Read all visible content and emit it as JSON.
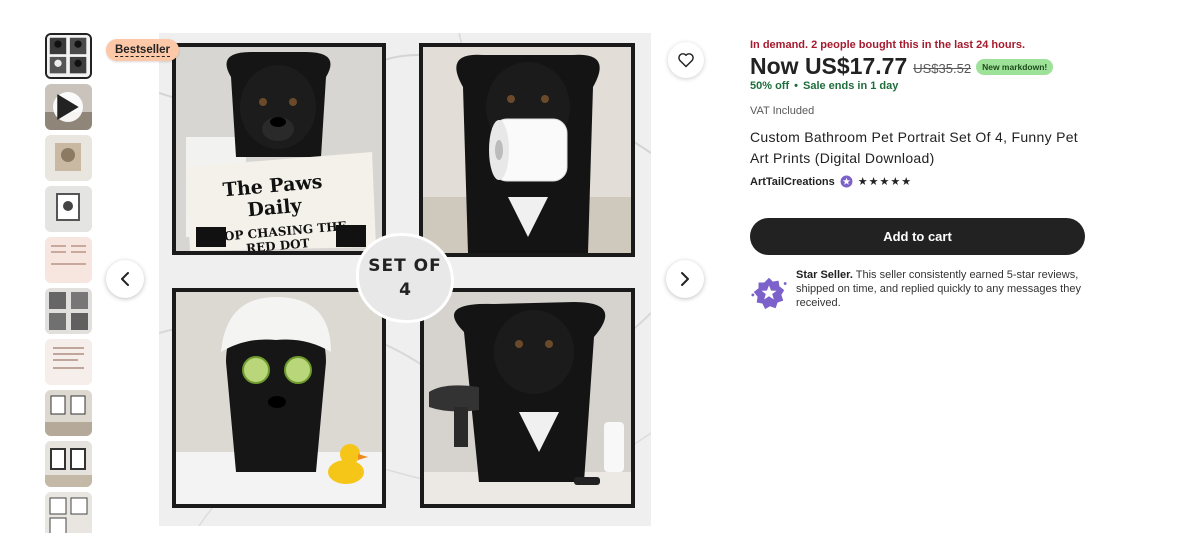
{
  "gallery": {
    "badge": "Bestseller",
    "newspaper_title": "The Paws Daily",
    "newspaper_headline": "STOP CHASING THE RED DOT",
    "set_label_line1": "SET OF",
    "set_label_line2": "4",
    "thumbnail_count": 10
  },
  "listing": {
    "demand_text": "In demand. 2 people bought this in the last 24 hours.",
    "price_now": "Now US$17.77",
    "price_original": "US$35.52",
    "markdown_badge": "New markdown!",
    "discount": "50% off",
    "sale_ends": "Sale ends in 1 day",
    "vat": "VAT Included",
    "title": "Custom Bathroom Pet Portrait Set Of 4, Funny Pet Art Prints (Digital Download)",
    "shop_name": "ArtTailCreations",
    "rating_stars": "★★★★★",
    "rating_value": 5,
    "add_to_cart": "Add to cart",
    "star_seller_label": "Star Seller.",
    "star_seller_text": "This seller consistently earned 5-star reviews, shipped on time, and replied quickly to any messages they received."
  },
  "colors": {
    "demand_red": "#a61a2e",
    "sale_green": "#1f6d3d",
    "markdown_green": "#9ee29a",
    "badge_peach": "#fcc8a8",
    "star_seller_purple": "#7b61c9",
    "button_dark": "#222222"
  },
  "icons": {
    "previous": "chevron-left-icon",
    "next": "chevron-right-icon",
    "favorite": "heart-icon",
    "video": "play-icon",
    "star_seller": "star-seller-icon"
  }
}
